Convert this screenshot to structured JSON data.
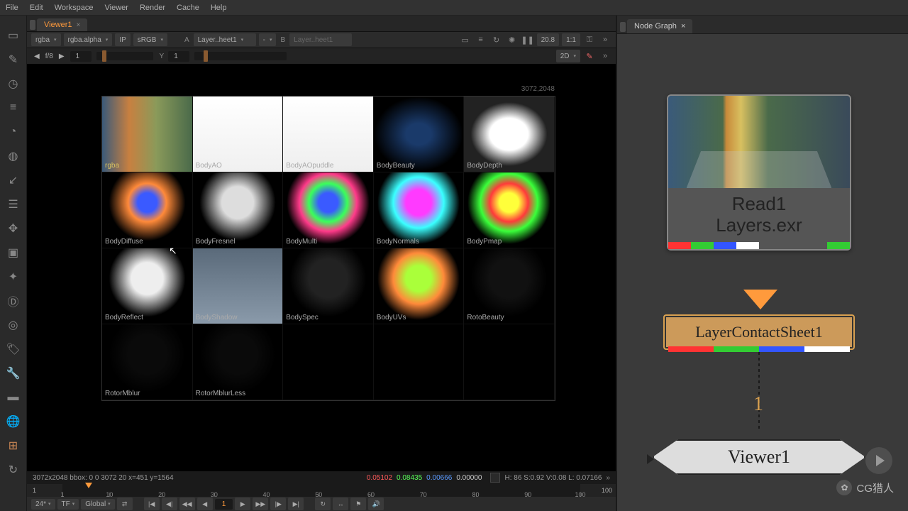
{
  "menu": [
    "File",
    "Edit",
    "Workspace",
    "Viewer",
    "Render",
    "Cache",
    "Help"
  ],
  "viewer_tab": "Viewer1",
  "toolbar": {
    "channel": "rgba",
    "alpha": "rgba.alpha",
    "ip": "IP",
    "colorspace": "sRGB",
    "a_label": "A",
    "a_val": "Layer..heet1",
    "dash": "-",
    "b_label": "B",
    "b_val": "Layer..heet1",
    "zoom": "20.8",
    "ratio": "1:1"
  },
  "fstop": {
    "label": "f/8",
    "val": "1",
    "y_label": "Y",
    "y_val": "1",
    "mode": "2D"
  },
  "canvas": {
    "dims": "3072,2048",
    "layers": [
      "rgba",
      "BodyAO",
      "BodyAOpuddle",
      "BodyBeauty",
      "BodyDepth",
      "BodyDiffuse",
      "BodyFresnel",
      "BodyMulti",
      "BodyNormals",
      "BodyPmap",
      "BodyReflect",
      "BodyShadow",
      "BodySpec",
      "BodyUVs",
      "RotoBeauty",
      "RotorMblur",
      "RotorMblurLess",
      "",
      "",
      ""
    ]
  },
  "status": {
    "dims": "3072x2048  bbox: 0 0 3072 20  x=451 y=1564",
    "r": "0.05102",
    "g": "0.08435",
    "b": "0.00666",
    "a": "0.00000",
    "hsv": "H: 86 S:0.92 V:0.08  L: 0.07166"
  },
  "timeline": {
    "start": "1",
    "end": "100",
    "ticks": [
      1,
      10,
      20,
      30,
      40,
      50,
      60,
      70,
      80,
      90,
      100
    ]
  },
  "transport": {
    "fps": "24*",
    "tf": "TF",
    "global": "Global",
    "frame": "1"
  },
  "nodegraph": {
    "tab": "Node Graph",
    "read": {
      "title": "Read1",
      "file": "Layers.exr"
    },
    "lcs": "LayerContactSheet1",
    "pipe": "1",
    "viewer": "Viewer1"
  },
  "watermark": "CG猎人",
  "chart_data": {
    "type": "table",
    "title": "Layer Contact Sheet passes",
    "categories": [
      "rgba",
      "BodyAO",
      "BodyAOpuddle",
      "BodyBeauty",
      "BodyDepth",
      "BodyDiffuse",
      "BodyFresnel",
      "BodyMulti",
      "BodyNormals",
      "BodyPmap",
      "BodyReflect",
      "BodyShadow",
      "BodySpec",
      "BodyUVs",
      "RotoBeauty",
      "RotorMblur",
      "RotorMblurLess"
    ]
  }
}
